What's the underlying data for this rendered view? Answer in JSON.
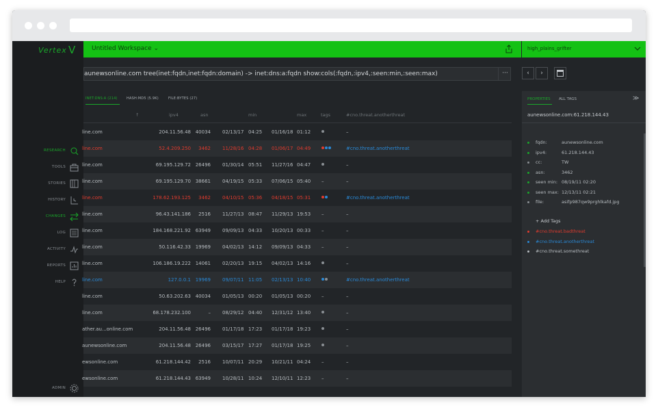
{
  "app": {
    "logo_text": "Vertex",
    "logo_mark": "V",
    "workspace_title": "Untitled Workspace",
    "user": "high_plains_grifter"
  },
  "colors": {
    "accent": "#14c114",
    "red": "#e23b2e",
    "blue": "#2a8ad8",
    "grey": "#8a8f94"
  },
  "sidebar": {
    "items": [
      {
        "label": "RESEARCH",
        "icon": "search-icon",
        "active": true
      },
      {
        "label": "TOOLS",
        "icon": "toolbox-icon",
        "active": false
      },
      {
        "label": "STORIES",
        "icon": "book-icon",
        "active": false
      },
      {
        "label": "HISTORY",
        "icon": "history-icon",
        "active": false
      },
      {
        "label": "CHANGES",
        "icon": "changes-icon",
        "active": true
      },
      {
        "label": "LOG",
        "icon": "log-icon",
        "active": false
      },
      {
        "label": "ACTIVITY",
        "icon": "activity-icon",
        "active": false
      },
      {
        "label": "REPORTS",
        "icon": "reports-icon",
        "active": false
      },
      {
        "label": "HELP",
        "icon": "help-icon",
        "active": false
      }
    ],
    "admin_label": "ADMIN"
  },
  "query": {
    "text": "aunewsonline.com tree(inet:fqdn,inet:fqdn:domain) -> inet:dns:a:fqdn show:cols(:fqdn,:ipv4,:seen:min,:seen:max)",
    "more": "···"
  },
  "nav": {
    "back": "‹",
    "forward": "›"
  },
  "tabs": [
    {
      "label": "INET:DNS:A (214)",
      "active": true
    },
    {
      "label": "HASH:MD5 (5.9K)",
      "active": false
    },
    {
      "label": "FILE:BYTES (27)",
      "active": false
    }
  ],
  "columns": {
    "sort": "↑",
    "ipv4": "ipv4",
    "asn": "asn",
    "min": "min",
    "max": "max",
    "tags": "tags",
    "tag": "#cno.threat.anotherthreat"
  },
  "rows": [
    {
      "fqdn": "line.com",
      "ipv4": "204.11.56.48",
      "asn": "40034",
      "min_date": "02/13/17",
      "min_time": "04:25",
      "max_date": "01/16/18",
      "max_time": "01:12",
      "tag_dots": [
        "#8a8f94"
      ],
      "tag": "–",
      "style": "normal"
    },
    {
      "fqdn": "line.com",
      "ipv4": "52.4.209.250",
      "asn": "3462",
      "min_date": "11/28/16",
      "min_time": "04:28",
      "max_date": "01/06/17",
      "max_time": "04:49",
      "tag_dots": [
        "#e23b2e",
        "#2a8ad8",
        "#2a8ad8"
      ],
      "tag": "#cno.threat.anotherthreat",
      "style": "red"
    },
    {
      "fqdn": "line.com",
      "ipv4": "69.195.129.72",
      "asn": "26496",
      "min_date": "01/30/14",
      "min_time": "05:51",
      "max_date": "11/27/16",
      "max_time": "04:47",
      "tag_dots": [
        "#8a8f94"
      ],
      "tag": "–",
      "style": "normal"
    },
    {
      "fqdn": "line.com",
      "ipv4": "69.195.129.70",
      "asn": "38661",
      "min_date": "04/19/15",
      "min_time": "05:33",
      "max_date": "07/06/15",
      "max_time": "05:40",
      "tag_dots": [],
      "tag": "–",
      "style": "normal"
    },
    {
      "fqdn": "line.com",
      "ipv4": "178.62.193.125",
      "asn": "3462",
      "min_date": "04/10/15",
      "min_time": "05:36",
      "max_date": "04/18/15",
      "max_time": "05:31",
      "tag_dots": [
        "#e23b2e",
        "#2a8ad8"
      ],
      "tag": "#cno.threat.anotherthreat",
      "style": "red"
    },
    {
      "fqdn": "line.com",
      "ipv4": "96.43.141.186",
      "asn": "2516",
      "min_date": "11/27/13",
      "min_time": "08:47",
      "max_date": "11/29/13",
      "max_time": "19:53",
      "tag_dots": [],
      "tag": "–",
      "style": "normal"
    },
    {
      "fqdn": "line.com",
      "ipv4": "184.168.221.92",
      "asn": "63949",
      "min_date": "09/09/13",
      "min_time": "04:33",
      "max_date": "10/20/13",
      "max_time": "00:33",
      "tag_dots": [],
      "tag": "–",
      "style": "normal"
    },
    {
      "fqdn": "line.com",
      "ipv4": "50.116.42.33",
      "asn": "19969",
      "min_date": "04/02/13",
      "min_time": "14:12",
      "max_date": "09/09/13",
      "max_time": "04:33",
      "tag_dots": [],
      "tag": "–",
      "style": "normal"
    },
    {
      "fqdn": "line.com",
      "ipv4": "106.186.19.222",
      "asn": "14061",
      "min_date": "02/20/13",
      "min_time": "19:15",
      "max_date": "04/02/13",
      "max_time": "14:16",
      "tag_dots": [
        "#8a8f94"
      ],
      "tag": "–",
      "style": "normal"
    },
    {
      "fqdn": "line.com",
      "ipv4": "127.0.0.1",
      "asn": "19969",
      "min_date": "09/07/11",
      "min_time": "11:05",
      "max_date": "02/13/13",
      "max_time": "10:40",
      "tag_dots": [
        "#2a8ad8",
        "#8a8f94"
      ],
      "tag": "#cno.threat.anotherthreat",
      "style": "blue"
    },
    {
      "fqdn": "line.com",
      "ipv4": "50.63.202.63",
      "asn": "40034",
      "min_date": "01/05/13",
      "min_time": "00:20",
      "max_date": "01/05/13",
      "max_time": "00:20",
      "tag_dots": [],
      "tag": "–",
      "style": "normal"
    },
    {
      "fqdn": "line.com",
      "ipv4": "68.178.232.100",
      "asn": "–",
      "min_date": "08/29/12",
      "min_time": "04:40",
      "max_date": "12/31/12",
      "max_time": "13:40",
      "tag_dots": [
        "#8a8f94"
      ],
      "tag": "–",
      "style": "normal"
    },
    {
      "fqdn": "ather.au...online.com",
      "ipv4": "204.11.56.48",
      "asn": "26496",
      "min_date": "01/17/18",
      "min_time": "17:23",
      "max_date": "01/17/18",
      "max_time": "19:23",
      "tag_dots": [
        "#8a8f94"
      ],
      "tag": "–",
      "style": "normal"
    },
    {
      "fqdn": "aunewsonline.com",
      "ipv4": "204.11.56.48",
      "asn": "26496",
      "min_date": "03/15/17",
      "min_time": "17:27",
      "max_date": "01/17/18",
      "max_time": "19:25",
      "tag_dots": [
        "#8a8f94"
      ],
      "tag": "–",
      "style": "normal"
    },
    {
      "fqdn": "ewsonline.com",
      "ipv4": "61.218.144.42",
      "asn": "2516",
      "min_date": "10/07/11",
      "min_time": "20:29",
      "max_date": "10/21/11",
      "max_time": "04:24",
      "tag_dots": [],
      "tag": "–",
      "style": "normal"
    },
    {
      "fqdn": "ewsonline.com",
      "ipv4": "61.218.144.43",
      "asn": "63949",
      "min_date": "10/28/11",
      "min_time": "10:24",
      "max_date": "12/10/11",
      "max_time": "12:23",
      "tag_dots": [],
      "tag": "–",
      "style": "normal"
    }
  ],
  "panel": {
    "tabs": [
      {
        "label": "PROPERTIES",
        "active": true
      },
      {
        "label": "ALL TAGS",
        "active": false
      }
    ],
    "expand": "≫",
    "node": "aunewsonline.com:61.218.144.43",
    "props": [
      {
        "key": "fqdn:",
        "value": "aunewsonline.com",
        "bullet": "#1aa82a"
      },
      {
        "key": "ipv4:",
        "value": "61.218.144.43",
        "bullet": "#1aa82a"
      },
      {
        "key": "cc:",
        "value": "TW",
        "bullet": "#8a8f94"
      },
      {
        "key": "asn:",
        "value": "3462",
        "bullet": "#1aa82a"
      },
      {
        "key": "seen min:",
        "value": "08/19/11  02:20",
        "bullet": "#1aa82a"
      },
      {
        "key": "seen max:",
        "value": "12/13/11  02:21",
        "bullet": "#1aa82a"
      },
      {
        "key": "file:",
        "value": "asifp987qw9prghlkafd.jpg",
        "bullet": "#8a8f94"
      }
    ],
    "add_tags": "+  Add Tags",
    "tags": [
      {
        "label": "#cno.threat.badthreat",
        "color": "#e23b2e"
      },
      {
        "label": "#cno.threat.anotherthreat",
        "color": "#2a8ad8"
      },
      {
        "label": "#cno.threat.somethreat",
        "color": "#b9bec2"
      }
    ]
  }
}
